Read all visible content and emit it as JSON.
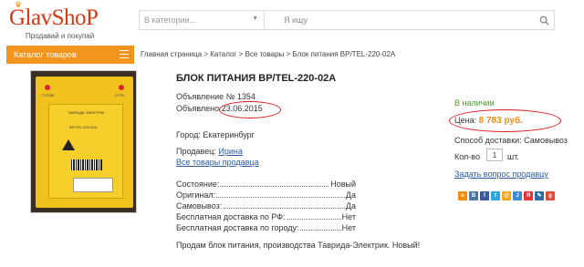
{
  "header": {
    "brand": "GlavShoP",
    "slogan": "Продавай и покупай",
    "category_placeholder": "В категории...",
    "search_placeholder": "Я ищу"
  },
  "catalog_button": "Каталог товаров",
  "breadcrumb": "Главная страница > Каталог > Все товары > Блок питания BP/TEL-220-02А",
  "product": {
    "title": "БЛОК ПИТАНИЯ BP/TEL-220-02А",
    "ad_number": "Объявление № 1354",
    "published_label": "Объявлено",
    "published_date": "23.06.2015",
    "city": "Город: Екатеринбург",
    "seller_label": "Продавец:",
    "seller_name": "Ирина",
    "seller_all_link": "Все товары продавца",
    "specs": [
      {
        "key": "Состояние:",
        "value": "Новый"
      },
      {
        "key": "Оригинал:",
        "value": "Да"
      },
      {
        "key": "Самовывоз:",
        "value": "Да"
      },
      {
        "key": "Бесплатная доставка по РФ:",
        "value": "Нет"
      },
      {
        "key": "Бесплатная доставка по городу:",
        "value": "Нет"
      }
    ],
    "description": "Продам блок питания, производства Таврида-Электрик. Новый!"
  },
  "photo": {
    "label_left": "ГОТОВ",
    "label_right": "ОТТЬ",
    "panel_brand": "ТАВРИДА ЭЛЕКТРИК",
    "panel_model": "BP/TEL-220-02А"
  },
  "sidebar": {
    "availability": "В наличии",
    "price_label": "Цена:",
    "price_value": "8 783 руб.",
    "delivery": "Способ доставки: Самовывоз",
    "qty_label": "Кол-во",
    "qty_value": "1",
    "qty_unit": "шт.",
    "ask_link": "Задать вопрос продавцу"
  },
  "colors": {
    "accent_orange": "#f3941d",
    "brand_red": "#d33a12",
    "highlight_circle": "#d91a1a",
    "instock_green": "#4a9a2e"
  },
  "share_icons": [
    "odnoklassniki-icon",
    "vkontakte-icon",
    "facebook-icon",
    "twitter-icon",
    "moimir-icon",
    "livejournal-icon",
    "yandex-icon",
    "liveinternet-icon",
    "googleplus-icon"
  ]
}
